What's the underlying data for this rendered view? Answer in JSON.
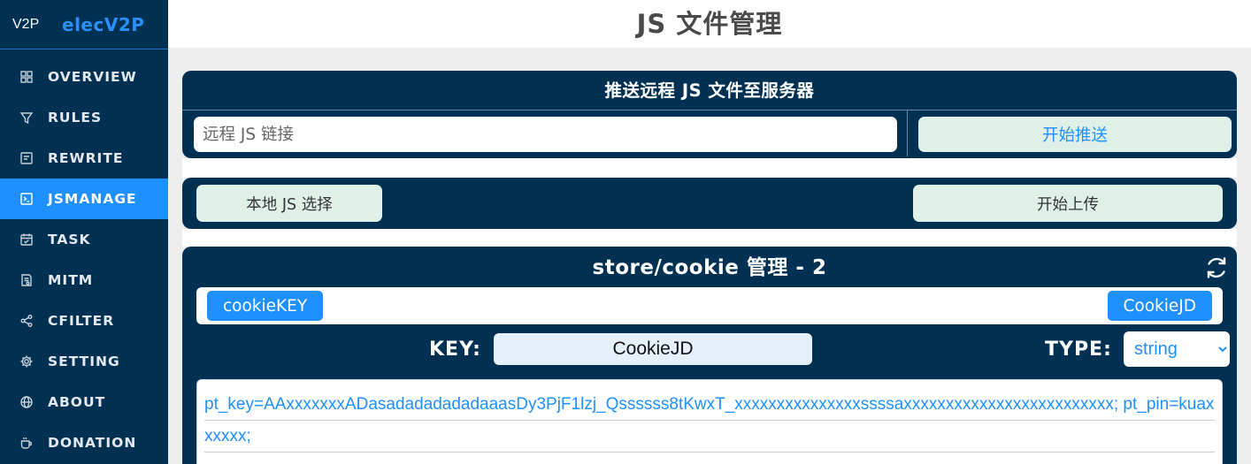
{
  "brand": {
    "logo": "V2P",
    "name": "elecV2P"
  },
  "sidebar": {
    "items": [
      {
        "label": "OVERVIEW",
        "icon": "grid-icon",
        "active": false
      },
      {
        "label": "RULES",
        "icon": "filter-icon",
        "active": false
      },
      {
        "label": "REWRITE",
        "icon": "rewrite-icon",
        "active": false
      },
      {
        "label": "JSMANAGE",
        "icon": "terminal-icon",
        "active": true
      },
      {
        "label": "TASK",
        "icon": "calendar-icon",
        "active": false
      },
      {
        "label": "MITM",
        "icon": "certificate-icon",
        "active": false
      },
      {
        "label": "CFILTER",
        "icon": "share-icon",
        "active": false
      },
      {
        "label": "SETTING",
        "icon": "gear-icon",
        "active": false
      },
      {
        "label": "ABOUT",
        "icon": "globe-icon",
        "active": false
      },
      {
        "label": "DONATION",
        "icon": "coffee-icon",
        "active": false
      }
    ]
  },
  "page": {
    "title": "JS 文件管理"
  },
  "push": {
    "heading": "推送远程 JS 文件至服务器",
    "placeholder": "远程 JS 链接",
    "button": "开始推送"
  },
  "upload": {
    "select_button": "本地 JS 选择",
    "upload_button": "开始上传"
  },
  "store": {
    "heading": "store/cookie 管理 - 2",
    "keys": [
      "cookieKEY",
      "CookieJD"
    ],
    "key_label": "KEY:",
    "key_value": "CookieJD",
    "type_label": "TYPE:",
    "type_value": "string",
    "value": "pt_key=AAxxxxxxxADasadadadadadaaasDy3PjF1lzj_Qssssss8tKwxT_xxxxxxxxxxxxxxxssssaxxxxxxxxxxxxxxxxxxxxxxxxx; pt_pin=kuaxxxxxx;"
  },
  "colors": {
    "sidebar_bg": "#003153",
    "active": "#1e90ff",
    "panel_bg": "#003153",
    "light_button": "#dff0e8"
  }
}
